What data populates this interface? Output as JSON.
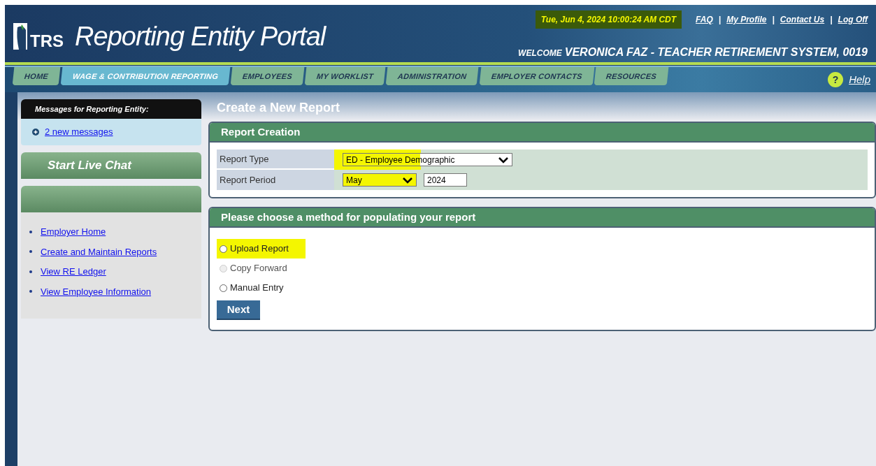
{
  "header": {
    "logo": "TRS",
    "title": "Reporting Entity Portal",
    "timestamp": "Tue, Jun 4, 2024 10:00:24 AM CDT",
    "links": [
      "FAQ",
      "My Profile",
      "Contact Us",
      "Log Off"
    ],
    "link_separator": "|",
    "welcome_label": "WELCOME",
    "welcome_name": "VERONICA FAZ - TEACHER RETIREMENT SYSTEM, 0019"
  },
  "nav": {
    "tabs": [
      {
        "label": "HOME",
        "selected": false
      },
      {
        "label": "WAGE & CONTRIBUTION REPORTING",
        "selected": true
      },
      {
        "label": "EMPLOYEES",
        "selected": false
      },
      {
        "label": "MY WORKLIST",
        "selected": false
      },
      {
        "label": "ADMINISTRATION",
        "selected": false
      },
      {
        "label": "EMPLOYER CONTACTS",
        "selected": false
      },
      {
        "label": "RESOURCES",
        "selected": false
      }
    ],
    "help": "Help",
    "help_icon": "?"
  },
  "sidebar": {
    "messages_title": "Messages for Reporting Entity:",
    "messages_link": "2 new messages",
    "live_chat": "Start Live Chat",
    "links": [
      "Employer Home",
      "Create and Maintain Reports",
      "View RE Ledger",
      "View Employee Information"
    ]
  },
  "page_title": "Create a New Report",
  "report_creation": {
    "title": "Report Creation",
    "report_type_label": "Report Type",
    "report_type_value": "ED - Employee Demographic",
    "report_period_label": "Report Period",
    "month": "May",
    "year": "2024"
  },
  "method": {
    "title": "Please choose a method for populating your report",
    "options": [
      {
        "label": "Upload Report",
        "selected": false,
        "disabled": false
      },
      {
        "label": "Copy Forward",
        "selected": false,
        "disabled": true
      },
      {
        "label": "Manual Entry",
        "selected": false,
        "disabled": false
      }
    ],
    "button": "Next"
  }
}
